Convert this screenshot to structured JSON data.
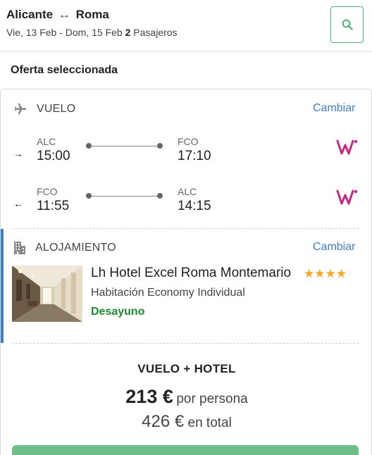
{
  "header": {
    "origin": "Alicante",
    "route_arrow": "↔",
    "destination": "Roma",
    "dates": "Vie, 13 Feb - Dom, 15 Feb",
    "passengers_count": "2",
    "passengers_label": "Pasajeros",
    "search_icon": "search-icon"
  },
  "section_title": "Oferta seleccionada",
  "flight": {
    "label": "VUELO",
    "icon": "plane-icon",
    "change_label": "Cambiar",
    "legs": [
      {
        "direction_glyph": "→",
        "from_code": "ALC",
        "from_time": "15:00",
        "to_code": "FCO",
        "to_time": "17:10",
        "airline_icon": "wizzair-logo"
      },
      {
        "direction_glyph": "←",
        "from_code": "FCO",
        "from_time": "11:55",
        "to_code": "ALC",
        "to_time": "14:15",
        "airline_icon": "wizzair-logo"
      }
    ]
  },
  "accommodation": {
    "label": "ALOJAMIENTO",
    "icon": "building-icon",
    "change_label": "Cambiar",
    "hotel_name": "Lh Hotel Excel Roma Montemario",
    "stars": 4,
    "stars_text": "★★★★",
    "room": "Habitación Economy Individual",
    "board": "Desayuno"
  },
  "package": {
    "title": "VUELO + HOTEL",
    "price_per_person": "213 €",
    "per_person_label": "por persona",
    "price_total": "426 €",
    "total_label": "en total"
  },
  "colors": {
    "accent_blue": "#3f7fc6",
    "green_text": "#1e8a2e",
    "cta_green": "#6cbf86",
    "star": "#f5a623",
    "wizz_magenta": "#c6287f"
  }
}
